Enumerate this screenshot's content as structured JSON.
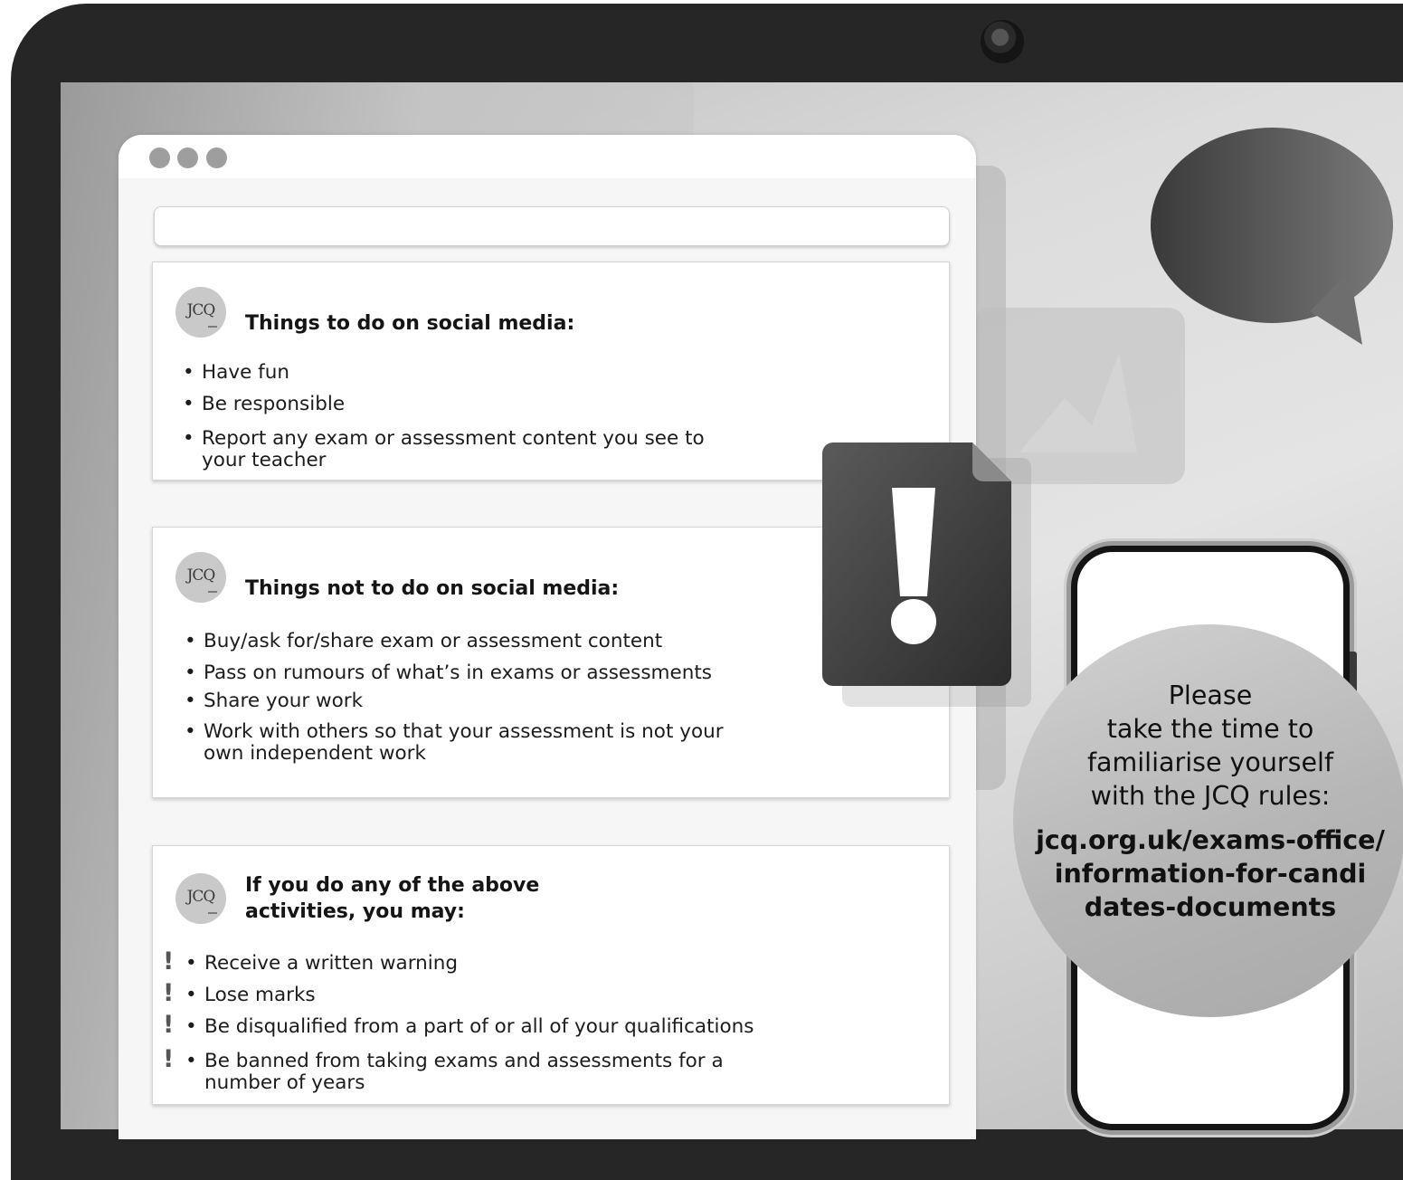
{
  "browser": {
    "address_value": ""
  },
  "cards": [
    {
      "logo_text": "JCQ",
      "title": "Things to do on social media:",
      "items": [
        [
          "Have fun"
        ],
        [
          "Be responsible"
        ],
        [
          "Report any exam or assessment content you see to",
          "your teacher"
        ]
      ]
    },
    {
      "logo_text": "JCQ",
      "title": "Things not to do on social media:",
      "items": [
        [
          "Buy/ask for/share exam or assessment content"
        ],
        [
          "Pass on rumours of what’s in exams or assessments"
        ],
        [
          "Share your work"
        ],
        [
          "Work with others so that your assessment is not your",
          "own independent work"
        ]
      ]
    },
    {
      "logo_text": "JCQ",
      "title_lines": [
        "If you do any of the above",
        "activities, you may:"
      ],
      "items": [
        [
          "Receive a written warning"
        ],
        [
          "Lose marks"
        ],
        [
          "Be disqualified from a part of or all of your qualifications"
        ],
        [
          "Be banned from taking exams and assessments for a",
          "number of years"
        ]
      ]
    }
  ],
  "notice": {
    "lines": [
      "Please",
      "take the time to",
      "familiarise yourself",
      "with the JCQ rules:"
    ],
    "url_lines": [
      "jcq.org.uk/exams-office/",
      "information-for-candi",
      "dates-documents"
    ]
  },
  "icons": {
    "window_dots": "window-controls-icon",
    "alert": "alert-document-icon",
    "speech": "speech-bubble-icon",
    "warning": "exclamation-icon"
  },
  "colors": {
    "bezel": "#262626",
    "card": "#ffffff",
    "accent_grey": "#3c3c3c"
  }
}
